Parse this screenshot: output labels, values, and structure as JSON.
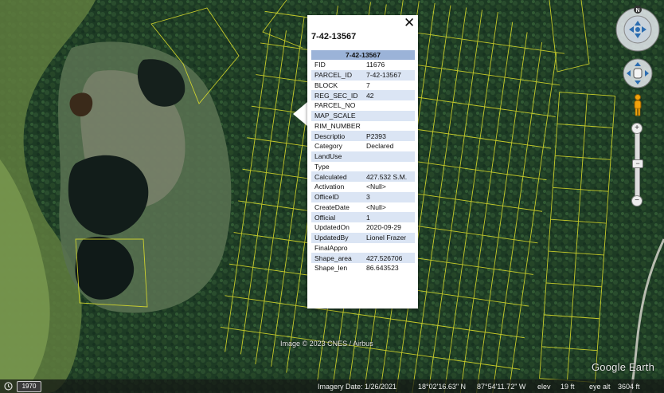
{
  "balloon": {
    "title": "7-42-13567",
    "table_header": "7-42-13567",
    "close_glyph": "✕",
    "rows": [
      {
        "k": "FID",
        "v": "11676"
      },
      {
        "k": "PARCEL_ID",
        "v": "7-42-13567"
      },
      {
        "k": "BLOCK",
        "v": "7"
      },
      {
        "k": "REG_SEC_ID",
        "v": "42"
      },
      {
        "k": "PARCEL_NO",
        "v": ""
      },
      {
        "k": "MAP_SCALE",
        "v": ""
      },
      {
        "k": "RIM_NUMBER",
        "v": ""
      },
      {
        "k": "Descriptio",
        "v": "P2393"
      },
      {
        "k": "Category",
        "v": "Declared"
      },
      {
        "k": "LandUse",
        "v": ""
      },
      {
        "k": "Type",
        "v": ""
      },
      {
        "k": "Calculated",
        "v": "427.532 S.M."
      },
      {
        "k": "Activation",
        "v": "<Null>"
      },
      {
        "k": "OfficeID",
        "v": "3"
      },
      {
        "k": "CreateDate",
        "v": "<Null>"
      },
      {
        "k": "Official",
        "v": "1"
      },
      {
        "k": "UpdatedOn",
        "v": "2020-09-29"
      },
      {
        "k": "UpdatedBy",
        "v": "Lionel Frazer"
      },
      {
        "k": "FinalAppro",
        "v": ""
      },
      {
        "k": "Shape_area",
        "v": "427.526706"
      },
      {
        "k": "Shape_len",
        "v": "86.643523"
      }
    ]
  },
  "map": {
    "copyright": "Image © 2023 CNES / Airbus",
    "logo": "Google Earth",
    "parcel_color": "#e3e32a"
  },
  "status": {
    "year": "1970",
    "imagery_date": "Imagery Date: 1/26/2021",
    "lat": "18°02'16.63\" N",
    "lon": "87°54'11.72\" W",
    "elev_label": "elev",
    "elev_value": "19 ft",
    "eye_label": "eye alt",
    "eye_value": "3604 ft"
  },
  "nav": {
    "north_label": "N",
    "zoom_in": "+",
    "zoom_out": "−",
    "slider_knob": "−"
  },
  "icons": [
    "history-clock-icon",
    "close-icon",
    "compass-icon",
    "pan-hand-icon",
    "pegman-icon"
  ]
}
